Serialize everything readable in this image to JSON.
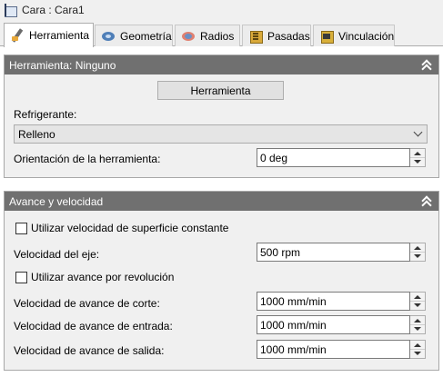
{
  "window": {
    "title": "Cara : Cara1"
  },
  "tabs": [
    {
      "label": "Herramienta",
      "icon": "tool-icon",
      "active": true
    },
    {
      "label": "Geometría",
      "icon": "geometry-icon"
    },
    {
      "label": "Radios",
      "icon": "radii-icon"
    },
    {
      "label": "Pasadas",
      "icon": "passes-icon"
    },
    {
      "label": "Vinculación",
      "icon": "linking-icon"
    }
  ],
  "tool_panel": {
    "header": "Herramienta: Ninguno",
    "tool_button": "Herramienta",
    "coolant_label": "Refrigerante:",
    "coolant_value": "Relleno",
    "orientation_label": "Orientación de la herramienta:",
    "orientation_value": "0 deg"
  },
  "feed_panel": {
    "header": "Avance y velocidad",
    "constant_surface_speed_label": "Utilizar velocidad de superficie constante",
    "constant_surface_speed_checked": false,
    "spindle_speed_label": "Velocidad del eje:",
    "spindle_speed_value": "500 rpm",
    "feed_per_rev_label": "Utilizar avance por revolución",
    "feed_per_rev_checked": false,
    "cutting_feed_label": "Velocidad de avance de corte:",
    "cutting_feed_value": "1000 mm/min",
    "lead_in_feed_label": "Velocidad de avance de entrada:",
    "lead_in_feed_value": "1000 mm/min",
    "lead_out_feed_label": "Velocidad de avance de salida:",
    "lead_out_feed_value": "1000 mm/min"
  },
  "colors": {
    "panel_header": "#707070",
    "panel_bg": "#f0f0f0",
    "tab_active_bg": "#ffffff"
  }
}
